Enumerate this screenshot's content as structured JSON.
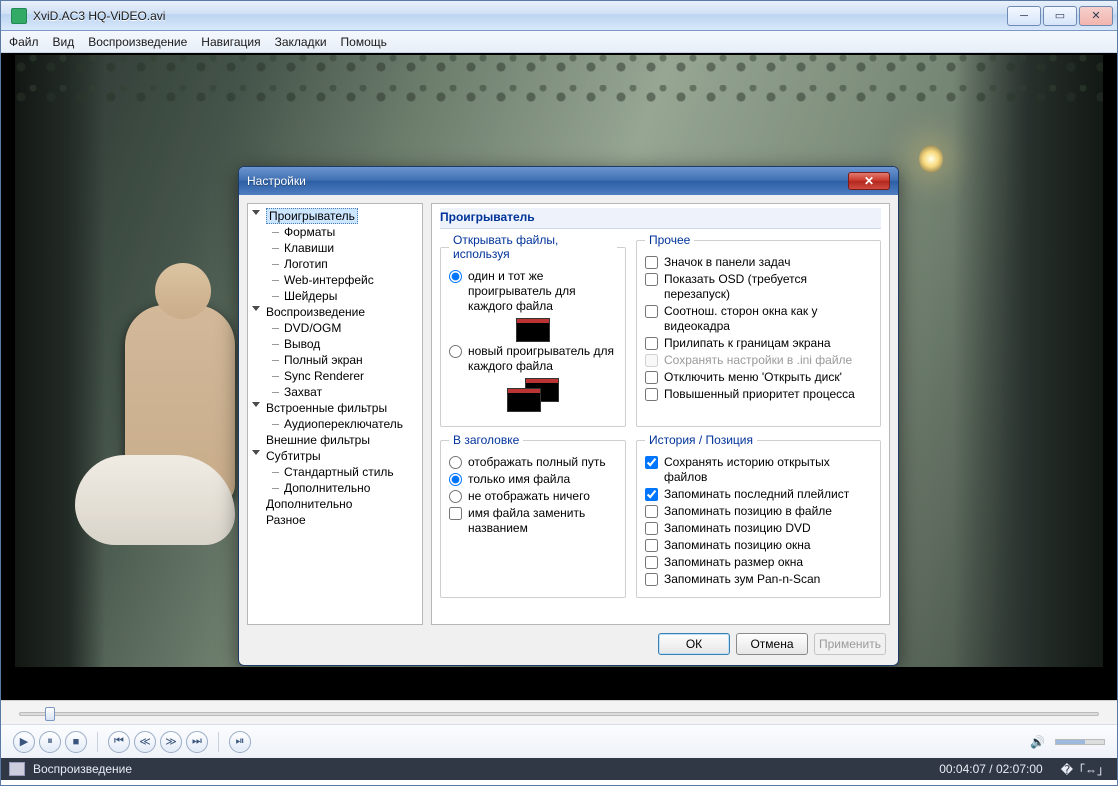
{
  "window": {
    "title_suffix": "XviD.AC3   HQ-ViDEO.avi"
  },
  "menu": {
    "items": [
      "Файл",
      "Вид",
      "Воспроизведение",
      "Навигация",
      "Закладки",
      "Помощь"
    ]
  },
  "status": {
    "text": "Воспроизведение",
    "time": "00:04:07 / 02:07:00"
  },
  "dialog": {
    "title": "Настройки",
    "section_heading": "Проигрыватель",
    "tree": [
      {
        "l": 1,
        "label": "Проигрыватель",
        "sel": true,
        "exp": true
      },
      {
        "l": 2,
        "label": "Форматы"
      },
      {
        "l": 2,
        "label": "Клавиши"
      },
      {
        "l": 2,
        "label": "Логотип"
      },
      {
        "l": 2,
        "label": "Web-интерфейс"
      },
      {
        "l": 2,
        "label": "Шейдеры"
      },
      {
        "l": 1,
        "label": "Воспроизведение",
        "exp": true
      },
      {
        "l": 2,
        "label": "DVD/OGM"
      },
      {
        "l": 2,
        "label": "Вывод"
      },
      {
        "l": 2,
        "label": "Полный экран"
      },
      {
        "l": 2,
        "label": "Sync Renderer"
      },
      {
        "l": 2,
        "label": "Захват"
      },
      {
        "l": 1,
        "label": "Встроенные фильтры",
        "exp": true
      },
      {
        "l": 2,
        "label": "Аудиопереключатель"
      },
      {
        "l": 1,
        "label": "Внешние фильтры"
      },
      {
        "l": 1,
        "label": "Субтитры",
        "exp": true
      },
      {
        "l": 2,
        "label": "Стандартный стиль"
      },
      {
        "l": 2,
        "label": "Дополнительно"
      },
      {
        "l": 1,
        "label": "Дополнительно"
      },
      {
        "l": 1,
        "label": "Разное"
      }
    ],
    "group_open": {
      "legend": "Открывать файлы, используя",
      "radio_same": "один и тот же проигрыватель для каждого файла",
      "radio_new": "новый проигрыватель для каждого файла",
      "selected": "same"
    },
    "group_other": {
      "legend": "Прочее",
      "items": [
        {
          "label": "Значок в панели задач",
          "checked": false
        },
        {
          "label": "Показать OSD (требуется перезапуск)",
          "checked": false
        },
        {
          "label": "Соотнош. сторон окна как у видеокадра",
          "checked": false
        },
        {
          "label": "Прилипать к границам экрана",
          "checked": false
        },
        {
          "label": "Сохранять настройки в .ini файле",
          "checked": false,
          "disabled": true
        },
        {
          "label": "Отключить меню 'Открыть диск'",
          "checked": false
        },
        {
          "label": "Повышенный приоритет процесса",
          "checked": false
        }
      ]
    },
    "group_title": {
      "legend": "В заголовке",
      "radios": [
        {
          "label": "отображать полный путь",
          "sel": false
        },
        {
          "label": "только имя файла",
          "sel": true
        },
        {
          "label": "не отображать ничего",
          "sel": false
        }
      ],
      "replace_name": {
        "label": "имя файла заменить названием",
        "checked": false
      }
    },
    "group_history": {
      "legend": "История / Позиция",
      "items": [
        {
          "label": "Сохранять историю открытых файлов",
          "checked": true
        },
        {
          "label": "Запоминать последний плейлист",
          "checked": true
        },
        {
          "label": "Запоминать позицию в файле",
          "checked": false
        },
        {
          "label": "Запоминать позицию DVD",
          "checked": false
        },
        {
          "label": "Запоминать позицию окна",
          "checked": false
        },
        {
          "label": "Запоминать размер окна",
          "checked": false
        },
        {
          "label": "Запоминать зум Pan-n-Scan",
          "checked": false
        }
      ]
    },
    "buttons": {
      "ok": "ОК",
      "cancel": "Отмена",
      "apply": "Применить"
    }
  }
}
